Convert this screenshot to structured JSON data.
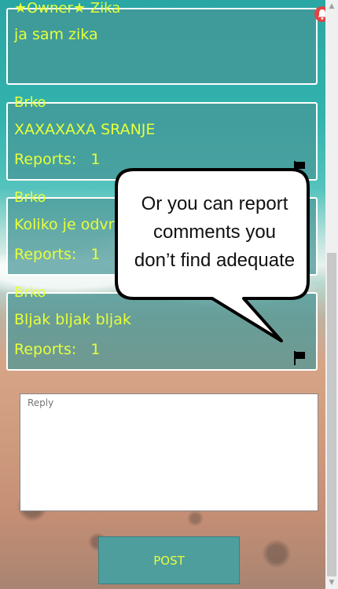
{
  "comments": [
    {
      "author": "★Owner★ Zika",
      "text": "ja sam zika",
      "reports_label": "",
      "reports_count": ""
    },
    {
      "author": "Brko",
      "text": "XAXAXAXA SRANJE",
      "reports_label": "Reports:",
      "reports_count": "1"
    },
    {
      "author": "Brko",
      "text": "Koliko je odvra",
      "reports_label": "Reports:",
      "reports_count": "1"
    },
    {
      "author": "Brko",
      "text": "Bljak bljak bljak",
      "reports_label": "Reports:",
      "reports_count": "1"
    }
  ],
  "tooltip": {
    "lines": [
      "Or you can report",
      "comments you",
      "don’t find adequate"
    ]
  },
  "reply": {
    "placeholder": "Reply",
    "value": ""
  },
  "post_label": "POST",
  "icons": {
    "notification": "bell-icon",
    "report": "flag-icon"
  },
  "colors": {
    "text_accent": "#e6ff3a",
    "button_bg": "#4f9e9e",
    "bell": "#e04444"
  }
}
